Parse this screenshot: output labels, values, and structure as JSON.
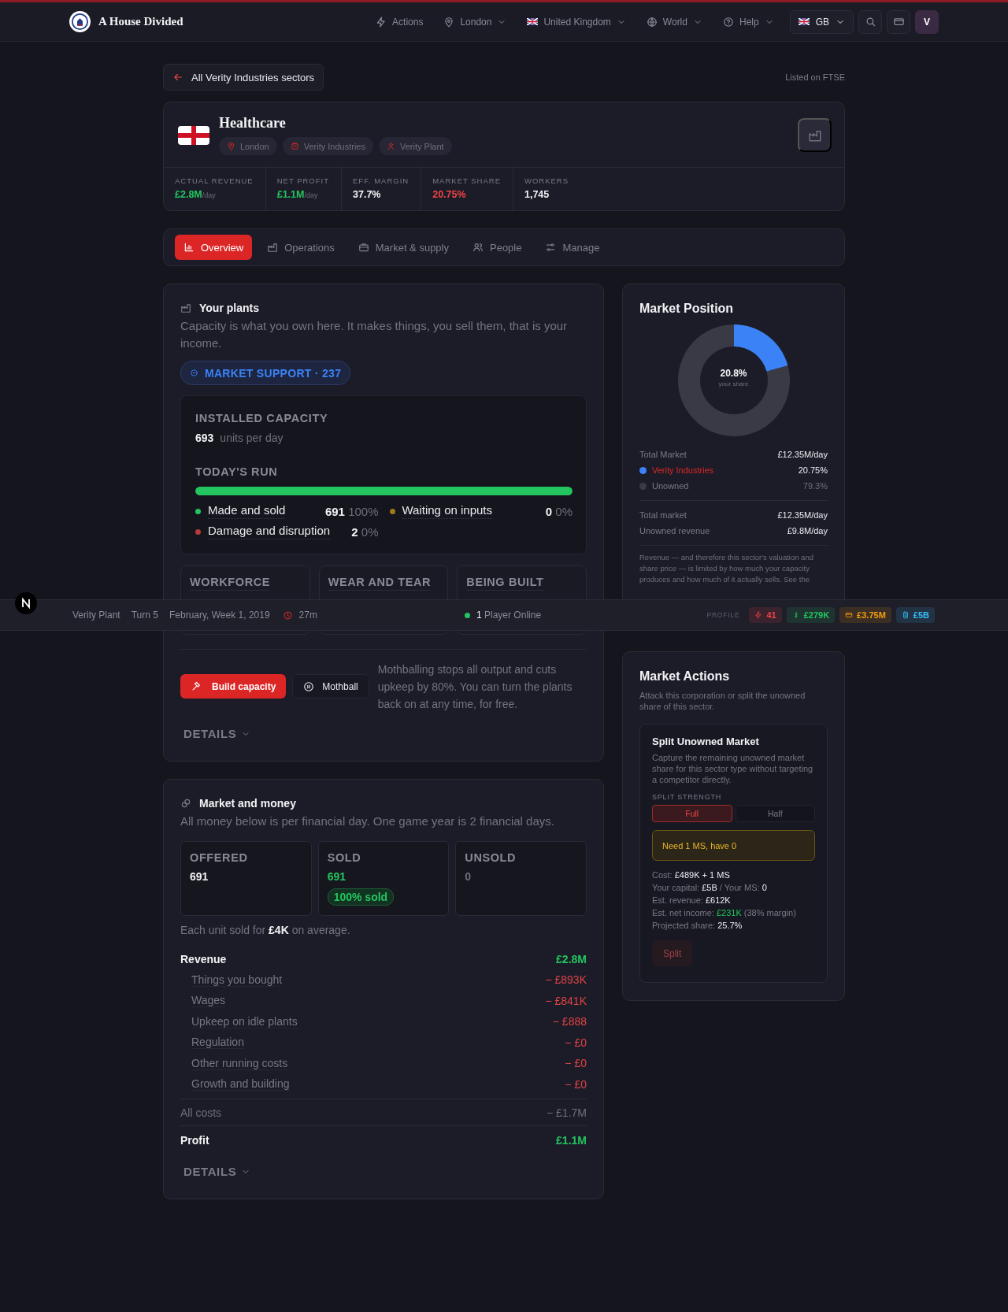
{
  "header": {
    "brand": "A House Divided",
    "nav": [
      {
        "label": "Actions",
        "caret": false
      },
      {
        "label": "London",
        "caret": true
      },
      {
        "label": "United Kingdom",
        "caret": true
      },
      {
        "label": "World",
        "caret": true
      },
      {
        "label": "Help",
        "caret": true
      }
    ],
    "region": "GB",
    "avatar": "V"
  },
  "back_link": "All Verity Industries sectors",
  "listing": "Listed on FTSE",
  "sector": {
    "title": "Healthcare",
    "tags": [
      "London",
      "Verity Industries",
      "Verity Plant"
    ],
    "stats": [
      {
        "label": "ACTUAL REVENUE",
        "value": "£2.8M",
        "unit": "/day"
      },
      {
        "label": "NET PROFIT",
        "value": "£1.1M",
        "unit": "/day"
      },
      {
        "label": "EFF. MARGIN",
        "value": "37.7%"
      },
      {
        "label": "MARKET SHARE",
        "value": "20.75%"
      },
      {
        "label": "WORKERS",
        "value": "1,745"
      }
    ]
  },
  "tabs": [
    {
      "label": "Overview",
      "selected": true
    },
    {
      "label": "Operations",
      "selected": false
    },
    {
      "label": "Market & supply",
      "selected": false
    },
    {
      "label": "People",
      "selected": false
    },
    {
      "label": "Manage",
      "selected": false
    }
  ],
  "plants": {
    "title": "Your plants",
    "description": "Capacity is what you own here. It makes things, you sell them, that is your income.",
    "badge": "MARKET SUPPORT · 237",
    "capacity": {
      "label": "INSTALLED CAPACITY",
      "value": "693",
      "unit": "units per day"
    },
    "run": {
      "label": "TODAY'S RUN",
      "level": 1,
      "items": [
        {
          "label": "Made and sold",
          "value": "691",
          "pct": "100%",
          "color": "#22c55e"
        },
        {
          "label": "Waiting on inputs",
          "value": "0",
          "pct": "0%",
          "color": "#a17a1a"
        },
        {
          "label": "Damage and disruption",
          "value": "2",
          "pct": "0%",
          "color": "#b83a3a"
        }
      ]
    },
    "cards": [
      "WORKFORCE",
      "WEAR AND TEAR",
      "BEING BUILT"
    ],
    "buttons": [
      {
        "label": "Build capacity",
        "kind": "primary"
      },
      {
        "label": "Mothball",
        "kind": "secondary"
      }
    ],
    "note": "Mothballing stops all output and cuts upkeep by 80%. You can turn the plants back on at any time, for free.",
    "details": "DETAILS"
  },
  "money": {
    "title": "Market and money",
    "description": "All money below is per financial day. One game year is 2 financial days.",
    "tiles": [
      {
        "label": "OFFERED",
        "value": "691"
      },
      {
        "label": "SOLD",
        "value": "691",
        "badge": "100% sold"
      },
      {
        "label": "UNSOLD",
        "value": "0"
      }
    ],
    "average": "Each unit sold for **£4K** on average.",
    "rows": [
      {
        "kind": "total",
        "label": "Revenue",
        "value": "£2.8M"
      },
      {
        "kind": "cost",
        "label": "Things you bought",
        "value": "− £893K"
      },
      {
        "kind": "cost",
        "label": "Wages",
        "value": "− £841K"
      },
      {
        "kind": "cost",
        "label": "Upkeep on idle plants",
        "value": "− £888"
      },
      {
        "kind": "cost",
        "label": "Regulation",
        "value": "− £0"
      },
      {
        "kind": "cost",
        "label": "Other running costs",
        "value": "− £0"
      },
      {
        "kind": "cost",
        "label": "Growth and building",
        "value": "− £0"
      },
      {
        "kind": "sum",
        "label": "All costs",
        "value": "− £1.7M"
      },
      {
        "kind": "total",
        "label": "Profit",
        "value": "£1.1M"
      }
    ],
    "details": "DETAILS"
  },
  "market_position": {
    "title": "Market Position",
    "center_value": "20.8%",
    "center_label": "your share",
    "chart_data": {
      "type": "donut",
      "categories": [
        "Verity Industries",
        "Unowned"
      ],
      "series": [
        {
          "values": [
            20.75,
            79.25
          ]
        }
      ]
    },
    "total": {
      "label": "Total Market",
      "value": "£12.35M/day"
    },
    "legend": [
      {
        "value": "20.75%",
        "color": "#3b82f6",
        "highlight": true
      },
      {
        "value": "79.3%",
        "color": "#3a3a46",
        "highlight": false
      }
    ],
    "summary": [
      {
        "label": "Total market",
        "value": "£12.35M/day"
      },
      {
        "label": "Unowned revenue",
        "value": "£9.8M/day"
      }
    ],
    "note": "Revenue — and therefore this sector's valuation and share price — is limited by how much your capacity produces and how much of it actually sells. See the"
  },
  "market_actions": {
    "title": "Market Actions",
    "description": "Attack this corporation or split the unowned share of this sector.",
    "card": {
      "title": "Split Unowned Market",
      "description": "Capture the remaining unowned market share for this sector type without targeting a competitor directly.",
      "strength_label": "SPLIT STRENGTH",
      "options": [
        {
          "label": "Full",
          "selected": true
        },
        {
          "label": "Half",
          "selected": false
        }
      ],
      "warning": "Need 1 MS, have 0",
      "lines": [
        [
          {
            "text": "Cost:",
            "kind": "label"
          },
          {
            "text": "£489K + 1 MS",
            "kind": "value"
          }
        ],
        [
          {
            "text": "Your capital:",
            "kind": "label"
          },
          {
            "text": "£5B",
            "kind": "value"
          },
          {
            "text": "/ Your MS:",
            "kind": "label"
          },
          {
            "text": "0",
            "kind": "value"
          }
        ],
        [
          {
            "text": "Est. revenue:",
            "kind": "label"
          },
          {
            "text": "£612K",
            "kind": "value"
          }
        ],
        [
          {
            "text": "Est. net income:",
            "kind": "label"
          },
          {
            "text": "£231K",
            "kind": "gain"
          },
          {
            "text": "(38% margin)",
            "kind": "label"
          }
        ],
        [
          {
            "text": "Projected share:",
            "kind": "label"
          },
          {
            "text": "25.7%",
            "kind": "value"
          }
        ]
      ],
      "action": {
        "label": "Split",
        "disabled": true
      }
    }
  },
  "status_bar": {
    "plant": "Verity Plant",
    "turn": "Turn 5",
    "date": "February, Week 1, 2019",
    "timer": "27m",
    "online": "**1** Player Online",
    "profile_label": "PROFILE",
    "chips": [
      {
        "value": "41",
        "color": "#ef4444"
      },
      {
        "value": "£279K",
        "color": "#22c55e"
      },
      {
        "value": "£3.75M",
        "color": "#f59e0b"
      },
      {
        "value": "£5B",
        "color": "#38bdf8"
      }
    ]
  }
}
